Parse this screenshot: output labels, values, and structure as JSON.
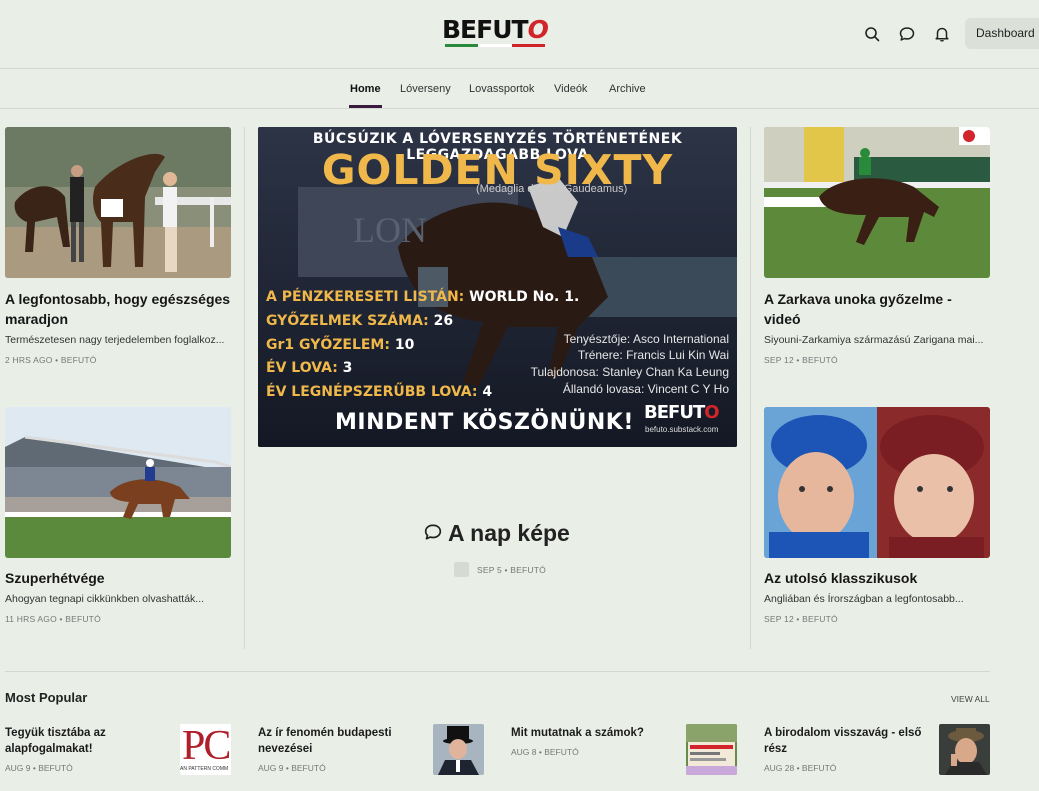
{
  "header": {
    "logo_text_a": "BEF",
    "logo_text_b": "U",
    "logo_text_c": "T",
    "logo_text_d": "O",
    "dashboard_label": "Dashboard",
    "icons": [
      "search-icon",
      "chat-icon",
      "bell-icon"
    ]
  },
  "nav": {
    "items": [
      {
        "label": "Home",
        "active": true
      },
      {
        "label": "Lóverseny"
      },
      {
        "label": "Lovassportok"
      },
      {
        "label": "Videók"
      },
      {
        "label": "Archive"
      }
    ]
  },
  "posts": {
    "left_top": {
      "title": "A legfontosabb, hogy egészséges maradjon",
      "desc": "Természetesen nagy terjedelemben foglalkoz...",
      "meta": "2 HRS AGO • BEFUTÓ"
    },
    "left_bottom": {
      "title": "Szuperhétvége",
      "desc": "Ahogyan tegnapi cikkünkben olvashatták...",
      "meta": "11 HRS AGO • BEFUTÓ"
    },
    "right_top": {
      "title": "A Zarkava unoka győzelme - videó",
      "desc": "Siyouni-Zarkamiya származású Zarigana mai...",
      "meta": "SEP 12 • BEFUTÓ"
    },
    "right_bottom": {
      "title": "Az utolsó klasszikusok",
      "desc": "Angliában és Írországban a legfontosabb...",
      "meta": "SEP 12 • BEFUTÓ"
    },
    "center": {
      "title": "A nap képe",
      "meta": "SEP 5 • BEFUTÓ"
    }
  },
  "hero": {
    "top_line": "BÚCSÚZIK A LÓVERSENYZÉS TÖRTÉNETÉNEK LEGGAZDAGABB LOVA",
    "headline": "GOLDEN SIXTY",
    "subline": "(Medaglia d'Oro - Gaudeamus)",
    "stats": [
      {
        "label": "A PÉNZKERESETI LISTÁN:",
        "value": " WORLD No. 1."
      },
      {
        "label": "GYŐZELMEK SZÁMA:",
        "value": " 26"
      },
      {
        "label": "Gr1 GYŐZELEM:",
        "value": " 10"
      },
      {
        "label": "ÉV LOVA:",
        "value": " 3"
      },
      {
        "label": "ÉV LEGNÉPSZERŰBB LOVA:",
        "value": " 4"
      }
    ],
    "info": [
      "Tenyésztője: Asco International",
      "Trénere: Francis Lui Kin Wai",
      "Tulajdonosa: Stanley Chan Ka Leung",
      "Állandó lovasa: Vincent C Y Ho"
    ],
    "thanks": "MINDENT KÖSZÖNÜNK!",
    "logo_a": "BEF",
    "logo_b": "U",
    "logo_c": "T",
    "logo_d": "O",
    "url": "befuto.substack.com",
    "stadium_word": "LON"
  },
  "popular": {
    "title": "Most Popular",
    "view_all": "VIEW ALL",
    "items": [
      {
        "title": "Tegyük tisztába az alapfogalmakat!",
        "meta": "AUG 9 • BEFUTÓ",
        "thumb_text": "PC",
        "thumb_sub": "AN PATTERN COMM"
      },
      {
        "title": "Az ír fenomén budapesti nevezései",
        "meta": "AUG 9 • BEFUTÓ"
      },
      {
        "title": "Mit mutatnak a számok?",
        "meta": "AUG 8 • BEFUTÓ"
      },
      {
        "title": "A birodalom visszavág - első rész",
        "meta": "AUG 28 • BEFUTÓ"
      }
    ]
  },
  "colors": {
    "accent": "#f0b84a",
    "brand_red": "#d1252b",
    "background": "#e9efe7",
    "nav_active": "#3b1a3f"
  }
}
